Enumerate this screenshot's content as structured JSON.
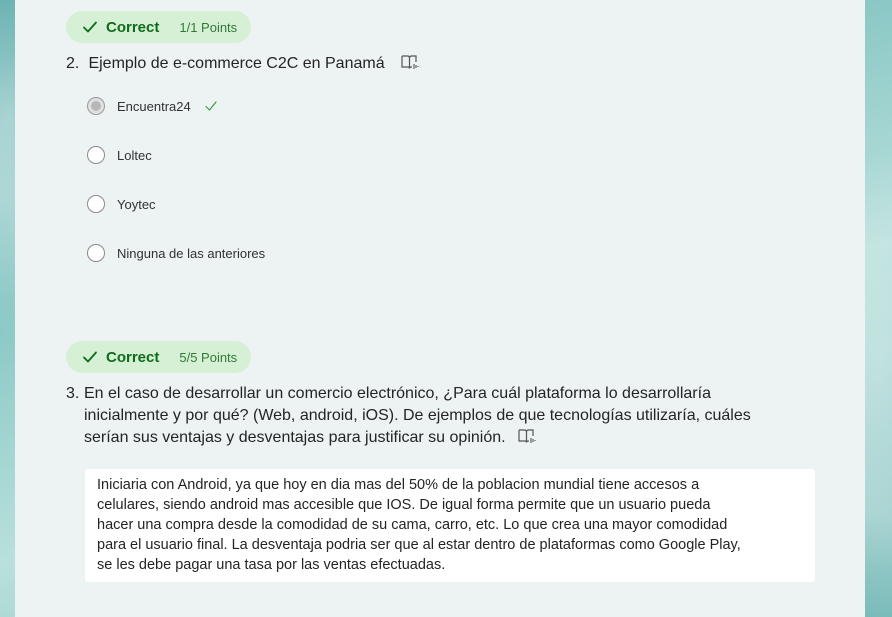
{
  "q2": {
    "status_label": "Correct",
    "points": "1/1 Points",
    "number": "2.",
    "title": "Ejemplo de e-commerce C2C en Panamá",
    "options": [
      {
        "label": "Encuentra24",
        "selected": true,
        "correct": true
      },
      {
        "label": "Loltec",
        "selected": false
      },
      {
        "label": "Yoytec",
        "selected": false
      },
      {
        "label": "Ninguna de las anteriores",
        "selected": false
      }
    ]
  },
  "q3": {
    "status_label": "Correct",
    "points": "5/5 Points",
    "number": "3.",
    "title_lines": [
      "En el caso de desarrollar un comercio electrónico, ¿Para cuál plataforma lo desarrollaría",
      "inicialmente y por qué? (Web, android, iOS). De ejemplos de que tecnologías utilizaría, cuáles",
      "serían sus ventajas y desventajas para justificar su opinión."
    ],
    "answer_lines": [
      "Iniciaria con Android, ya que hoy en dia mas del 50% de la poblacion mundial tiene accesos a",
      "celulares, siendo android mas accesible que IOS. De igual forma permite que un usuario pueda",
      "hacer una compra desde la comodidad de su cama, carro, etc. Lo que crea una mayor comodidad",
      "para el usuario final. La desventaja podria ser que al estar dentro de plataformas como Google Play,",
      "se les debe pagar una tasa por las ventas efectuadas."
    ]
  },
  "colors": {
    "correct_badge_bg": "#d6f0d6",
    "correct_text": "#0f6b1a",
    "panel_bg": "#ecf3f2"
  }
}
